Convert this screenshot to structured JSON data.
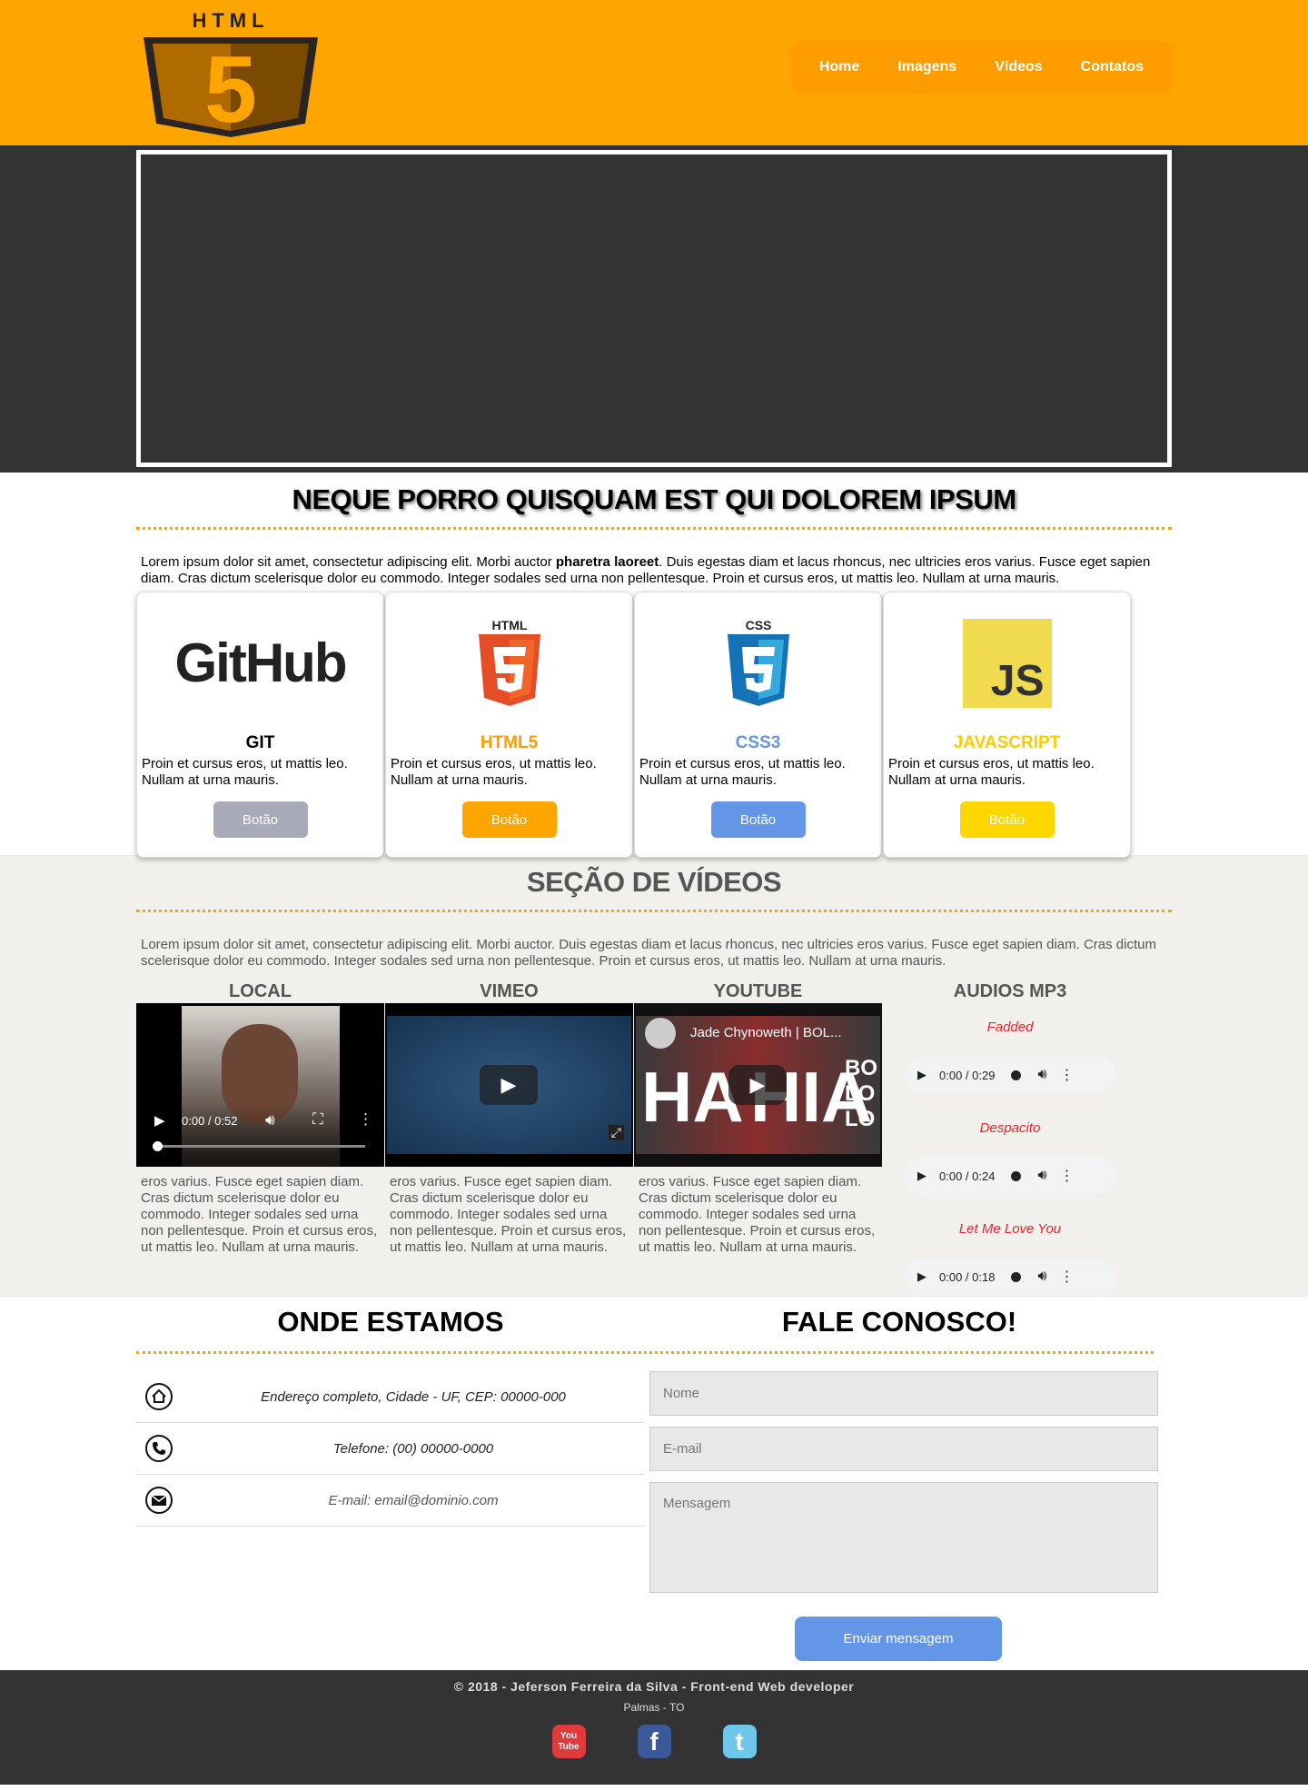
{
  "header": {
    "logo_text": "HTML",
    "logo_numeral": "5",
    "nav": [
      "Home",
      "Imagens",
      "Vídeos",
      "Contatos"
    ]
  },
  "section1": {
    "title": "NEQUE PORRO QUISQUAM EST QUI DOLOREM IPSUM",
    "lead_before": "Lorem ipsum dolor sit amet, consectetur adipiscing elit. Morbi auctor ",
    "lead_bold": "pharetra laoreet",
    "lead_after": ". Duis egestas diam et lacus rhoncus, nec ultricies eros varius. Fusce eget sapien diam. Cras dictum scelerisque dolor eu commodo. Integer sodales sed urna non pellentesque. Proin et cursus eros, ut mattis leo. Nullam at urna mauris.",
    "cards": [
      {
        "logo": "GitHub",
        "title": "GIT",
        "color": "#000000",
        "text": "Proin et cursus eros, ut mattis leo. Nullam at urna mauris.",
        "button": "Botão",
        "button_color": "#a9aab9"
      },
      {
        "logo": "HTML",
        "title": "HTML5",
        "color": "#ff9d00",
        "text": "Proin et cursus eros, ut mattis leo. Nullam at urna mauris.",
        "button": "Botão",
        "button_color": "#ffa500"
      },
      {
        "logo": "CSS",
        "title": "CSS3",
        "color": "#6496e8",
        "text": "Proin et cursus eros, ut mattis leo. Nullam at urna mauris.",
        "button": "Botão",
        "button_color": "#6496e8"
      },
      {
        "logo": "JS",
        "title": "JAVASCRIPT",
        "color": "#ffcc00",
        "text": "Proin et cursus eros, ut mattis leo. Nullam at urna mauris.",
        "button": "Botão",
        "button_color": "#ffd700"
      }
    ]
  },
  "videos": {
    "title": "SEÇÃO DE VÍDEOS",
    "lead": "Lorem ipsum dolor sit amet, consectetur adipiscing elit. Morbi auctor. Duis egestas diam et lacus rhoncus, nec ultricies eros varius. Fusce eget sapien diam. Cras dictum scelerisque dolor eu commodo. Integer sodales sed urna non pellentesque. Proin et cursus eros, ut mattis leo. Nullam at urna mauris.",
    "columns": [
      {
        "title": "LOCAL",
        "time": "0:00 / 0:52",
        "text": "eros varius. Fusce eget sapien diam. Cras dictum scelerisque dolor eu commodo. Integer sodales sed urna non pellentesque. Proin et cursus eros, ut mattis leo. Nullam at urna mauris."
      },
      {
        "title": "VIMEO",
        "text": "eros varius. Fusce eget sapien diam. Cras dictum scelerisque dolor eu commodo. Integer sodales sed urna non pellentesque. Proin et cursus eros, ut mattis leo. Nullam at urna mauris."
      },
      {
        "title": "YOUTUBE",
        "video_title": "Jade Chynoweth | BOL...",
        "overlay_left": "HA",
        "overlay_right": "HIA",
        "overlay_vertical": [
          "BO",
          "LO",
          "LO"
        ],
        "text": "eros varius. Fusce eget sapien diam. Cras dictum scelerisque dolor eu commodo. Integer sodales sed urna non pellentesque. Proin et cursus eros, ut mattis leo. Nullam at urna mauris."
      }
    ],
    "audio": {
      "title": "AUDIOS MP3",
      "tracks": [
        {
          "name": "Fadded",
          "time": "0:00 / 0:29"
        },
        {
          "name": "Despacito",
          "time": "0:00 / 0:24"
        },
        {
          "name": "Let Me Love You",
          "time": "0:00 / 0:18"
        }
      ]
    }
  },
  "contact": {
    "where_title": "ONDE ESTAMOS",
    "talk_title": "FALE CONOSCO!",
    "address": "Endereço completo, Cidade - UF, CEP: 00000-000",
    "phone": "Telefone: (00) 00000-0000",
    "email": "E-mail: email@dominio.com",
    "form": {
      "name_placeholder": "Nome",
      "email_placeholder": "E-mail",
      "message_placeholder": "Mensagem",
      "submit": "Enviar mensagem"
    }
  },
  "footer": {
    "copyright": "© 2018 - Jeferson Ferreira da Silva - Front-end Web developer",
    "location": "Palmas - TO",
    "social": [
      {
        "name": "youtube-icon",
        "label": "You Tube",
        "color": "#e03a3e"
      },
      {
        "name": "facebook-icon",
        "label": "f",
        "color": "#3b5998"
      },
      {
        "name": "twitter-icon",
        "label": "t",
        "color": "#6ec6ea"
      }
    ]
  }
}
